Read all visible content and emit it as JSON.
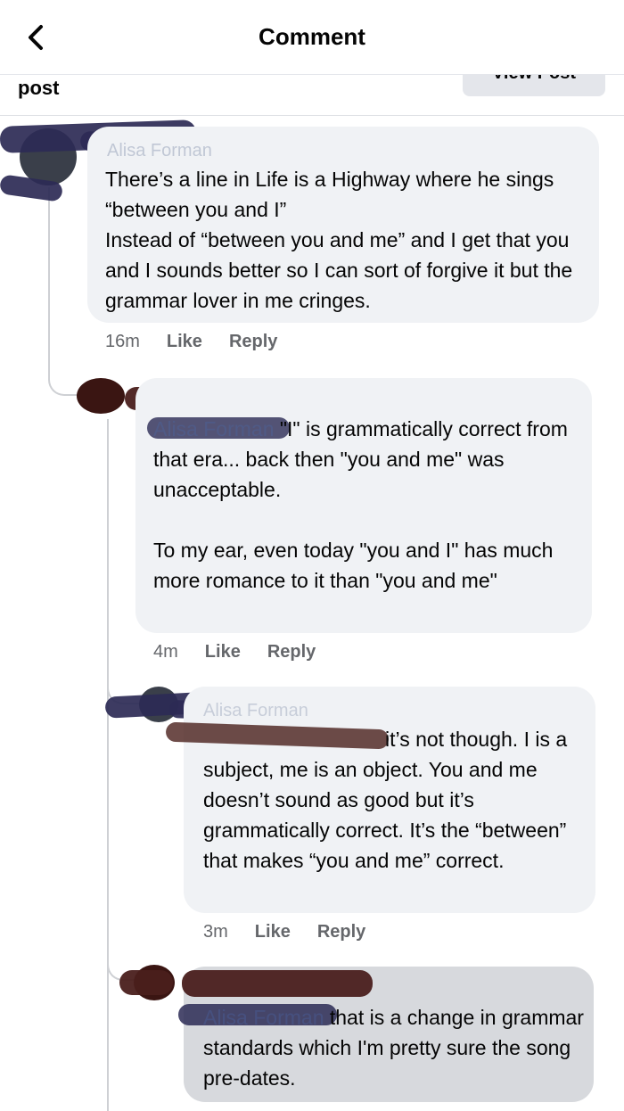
{
  "header": {
    "title": "Comment",
    "back_icon": "chevron-left-icon"
  },
  "post_bar": {
    "label": "post",
    "view_post": "View Post"
  },
  "comments": [
    {
      "author": "Alisa Forman",
      "text": "There’s a line in Life is a Highway where he sings “between you and I”\nInstead of “between you and me” and I get that you and I sounds better so I can sort of forgive it but the grammar lover in me cringes.",
      "time": "16m",
      "like": "Like",
      "reply": "Reply"
    },
    {
      "tag": "Alisa Forman",
      "text": " \"I\" is grammatically correct from that era... back then \"you and me\" was unacceptable.\n\nTo my ear, even today \"you and I\" has much more romance to it than \"you and me\"",
      "time": "4m",
      "like": "Like",
      "reply": "Reply"
    },
    {
      "author": "Alisa Forman",
      "text": "it’s not though. I is a subject, me is an object. You and me doesn’t sound as good but it’s grammatically correct. It’s the “between” that makes “you and me” correct.",
      "time": "3m",
      "like": "Like",
      "reply": "Reply"
    },
    {
      "tag": "Alisa Forman",
      "text": " that is a change in grammar standards which I'm pretty sure the song pre-dates."
    }
  ]
}
